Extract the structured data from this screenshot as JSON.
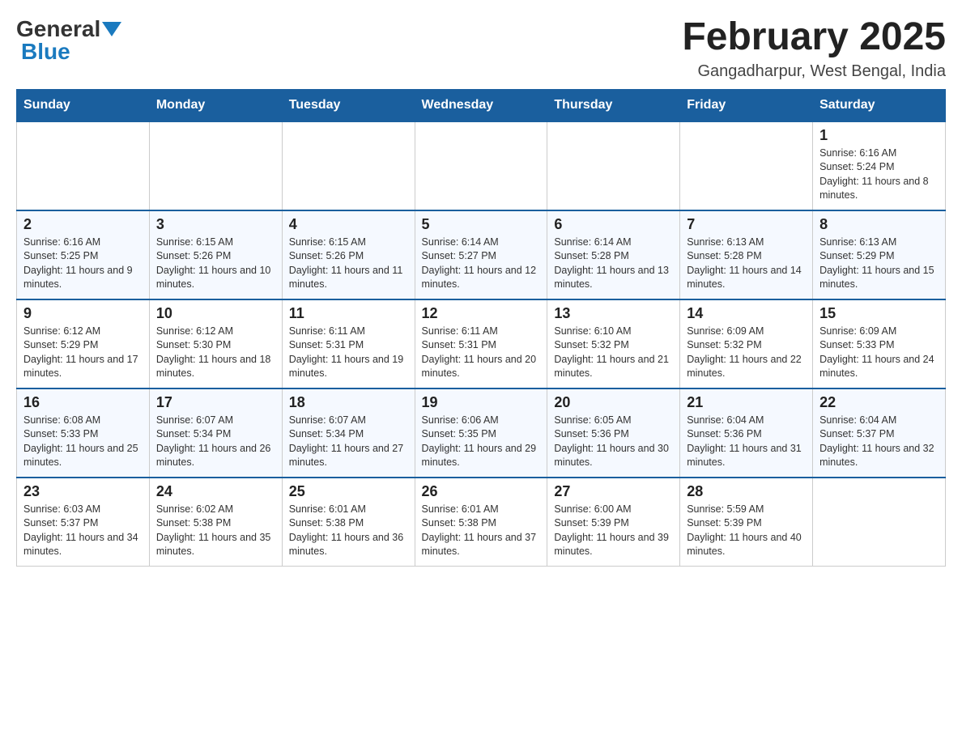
{
  "header": {
    "logo": {
      "general": "General",
      "blue": "Blue"
    },
    "title": "February 2025",
    "location": "Gangadharpur, West Bengal, India"
  },
  "days_of_week": [
    "Sunday",
    "Monday",
    "Tuesday",
    "Wednesday",
    "Thursday",
    "Friday",
    "Saturday"
  ],
  "weeks": [
    [
      {
        "day": "",
        "info": ""
      },
      {
        "day": "",
        "info": ""
      },
      {
        "day": "",
        "info": ""
      },
      {
        "day": "",
        "info": ""
      },
      {
        "day": "",
        "info": ""
      },
      {
        "day": "",
        "info": ""
      },
      {
        "day": "1",
        "info": "Sunrise: 6:16 AM\nSunset: 5:24 PM\nDaylight: 11 hours and 8 minutes."
      }
    ],
    [
      {
        "day": "2",
        "info": "Sunrise: 6:16 AM\nSunset: 5:25 PM\nDaylight: 11 hours and 9 minutes."
      },
      {
        "day": "3",
        "info": "Sunrise: 6:15 AM\nSunset: 5:26 PM\nDaylight: 11 hours and 10 minutes."
      },
      {
        "day": "4",
        "info": "Sunrise: 6:15 AM\nSunset: 5:26 PM\nDaylight: 11 hours and 11 minutes."
      },
      {
        "day": "5",
        "info": "Sunrise: 6:14 AM\nSunset: 5:27 PM\nDaylight: 11 hours and 12 minutes."
      },
      {
        "day": "6",
        "info": "Sunrise: 6:14 AM\nSunset: 5:28 PM\nDaylight: 11 hours and 13 minutes."
      },
      {
        "day": "7",
        "info": "Sunrise: 6:13 AM\nSunset: 5:28 PM\nDaylight: 11 hours and 14 minutes."
      },
      {
        "day": "8",
        "info": "Sunrise: 6:13 AM\nSunset: 5:29 PM\nDaylight: 11 hours and 15 minutes."
      }
    ],
    [
      {
        "day": "9",
        "info": "Sunrise: 6:12 AM\nSunset: 5:29 PM\nDaylight: 11 hours and 17 minutes."
      },
      {
        "day": "10",
        "info": "Sunrise: 6:12 AM\nSunset: 5:30 PM\nDaylight: 11 hours and 18 minutes."
      },
      {
        "day": "11",
        "info": "Sunrise: 6:11 AM\nSunset: 5:31 PM\nDaylight: 11 hours and 19 minutes."
      },
      {
        "day": "12",
        "info": "Sunrise: 6:11 AM\nSunset: 5:31 PM\nDaylight: 11 hours and 20 minutes."
      },
      {
        "day": "13",
        "info": "Sunrise: 6:10 AM\nSunset: 5:32 PM\nDaylight: 11 hours and 21 minutes."
      },
      {
        "day": "14",
        "info": "Sunrise: 6:09 AM\nSunset: 5:32 PM\nDaylight: 11 hours and 22 minutes."
      },
      {
        "day": "15",
        "info": "Sunrise: 6:09 AM\nSunset: 5:33 PM\nDaylight: 11 hours and 24 minutes."
      }
    ],
    [
      {
        "day": "16",
        "info": "Sunrise: 6:08 AM\nSunset: 5:33 PM\nDaylight: 11 hours and 25 minutes."
      },
      {
        "day": "17",
        "info": "Sunrise: 6:07 AM\nSunset: 5:34 PM\nDaylight: 11 hours and 26 minutes."
      },
      {
        "day": "18",
        "info": "Sunrise: 6:07 AM\nSunset: 5:34 PM\nDaylight: 11 hours and 27 minutes."
      },
      {
        "day": "19",
        "info": "Sunrise: 6:06 AM\nSunset: 5:35 PM\nDaylight: 11 hours and 29 minutes."
      },
      {
        "day": "20",
        "info": "Sunrise: 6:05 AM\nSunset: 5:36 PM\nDaylight: 11 hours and 30 minutes."
      },
      {
        "day": "21",
        "info": "Sunrise: 6:04 AM\nSunset: 5:36 PM\nDaylight: 11 hours and 31 minutes."
      },
      {
        "day": "22",
        "info": "Sunrise: 6:04 AM\nSunset: 5:37 PM\nDaylight: 11 hours and 32 minutes."
      }
    ],
    [
      {
        "day": "23",
        "info": "Sunrise: 6:03 AM\nSunset: 5:37 PM\nDaylight: 11 hours and 34 minutes."
      },
      {
        "day": "24",
        "info": "Sunrise: 6:02 AM\nSunset: 5:38 PM\nDaylight: 11 hours and 35 minutes."
      },
      {
        "day": "25",
        "info": "Sunrise: 6:01 AM\nSunset: 5:38 PM\nDaylight: 11 hours and 36 minutes."
      },
      {
        "day": "26",
        "info": "Sunrise: 6:01 AM\nSunset: 5:38 PM\nDaylight: 11 hours and 37 minutes."
      },
      {
        "day": "27",
        "info": "Sunrise: 6:00 AM\nSunset: 5:39 PM\nDaylight: 11 hours and 39 minutes."
      },
      {
        "day": "28",
        "info": "Sunrise: 5:59 AM\nSunset: 5:39 PM\nDaylight: 11 hours and 40 minutes."
      },
      {
        "day": "",
        "info": ""
      }
    ]
  ]
}
